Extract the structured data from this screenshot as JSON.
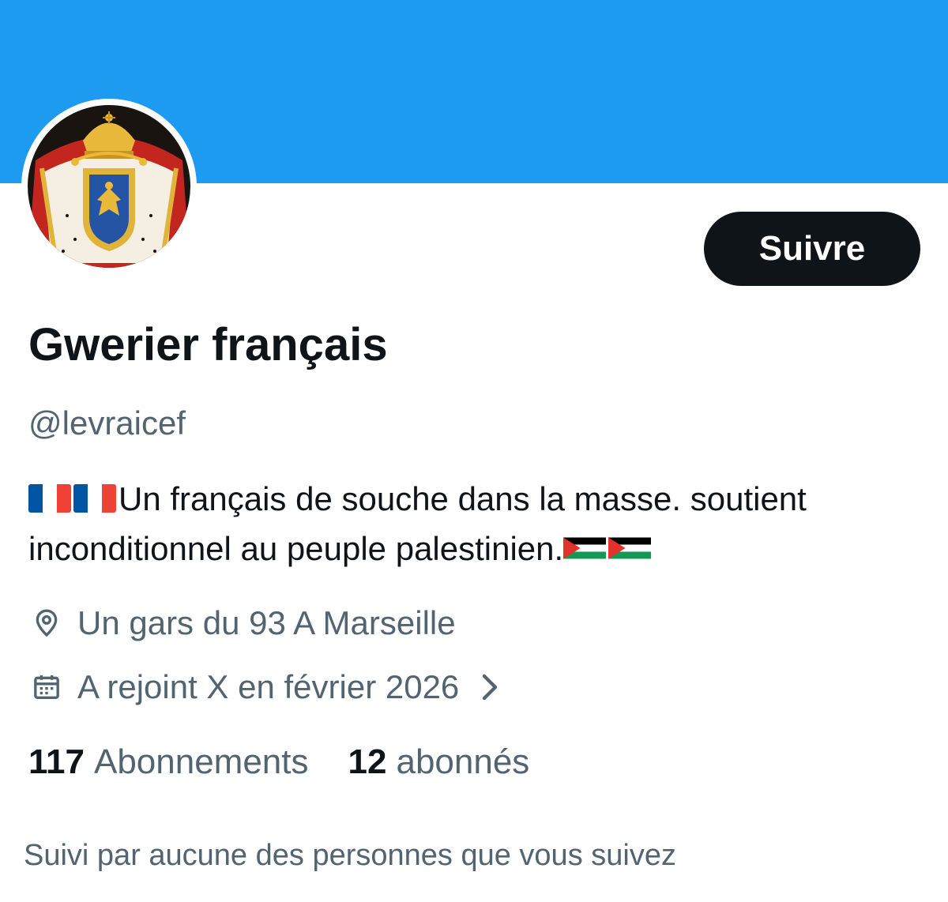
{
  "colors": {
    "banner": "#1d9bf0",
    "follow_button_bg": "#0f1419",
    "secondary_text": "#536471"
  },
  "profile": {
    "display_name": "Gwerier français",
    "handle": "@levraicef",
    "bio_text": "Un français de souche dans la masse. soutient inconditionnel au peuple palestinien.",
    "bio_leading_flags": [
      "flag-france",
      "flag-france"
    ],
    "bio_trailing_flags": [
      "flag-palestine",
      "flag-palestine"
    ],
    "location": "Un gars du 93 A Marseille",
    "joined": "A rejoint X en février 2026"
  },
  "actions": {
    "follow_label": "Suivre"
  },
  "stats": {
    "following_count": "117",
    "following_label": "Abonnements",
    "followers_count": "12",
    "followers_label": "abonnés"
  },
  "followed_by_text": "Suivi par aucune des personnes que vous suivez",
  "icons": {
    "location": "location-pin-icon",
    "calendar": "calendar-icon",
    "chevron": "chevron-right-icon"
  }
}
